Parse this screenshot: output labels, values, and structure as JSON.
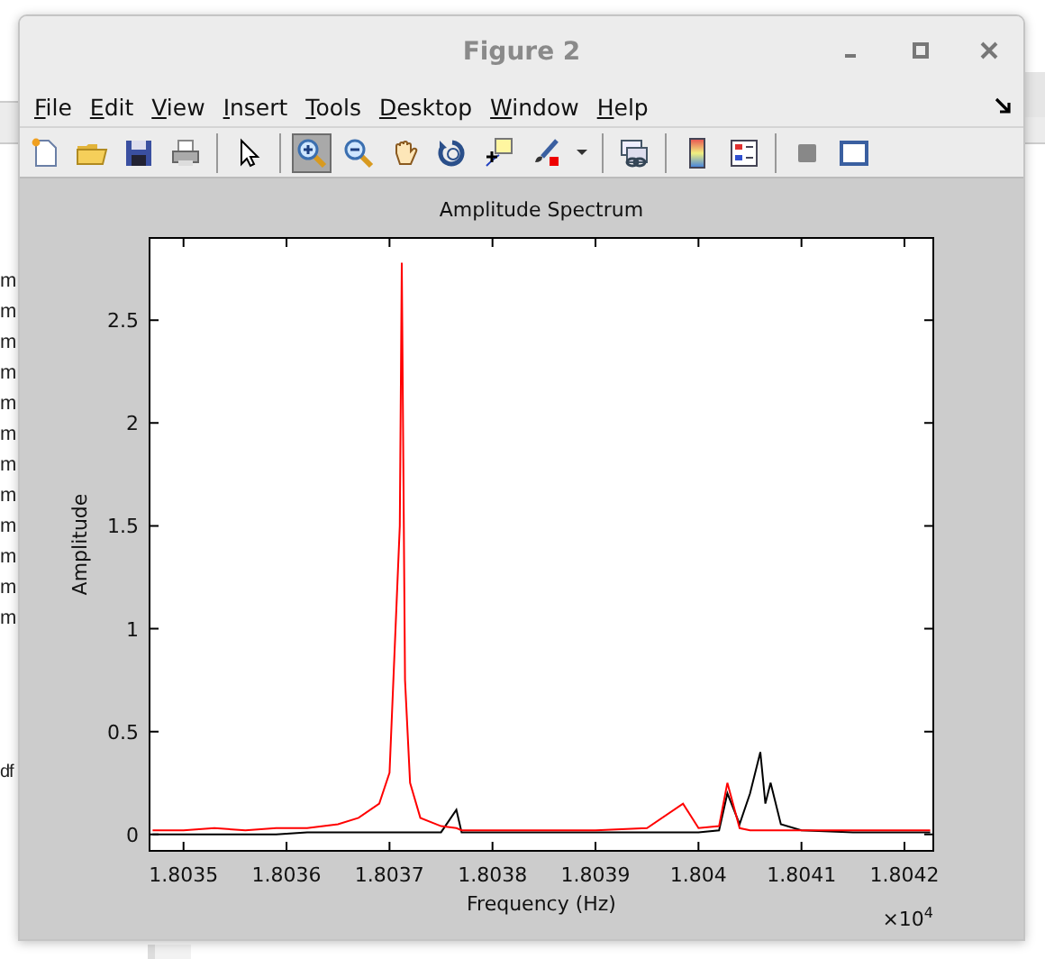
{
  "background": {
    "files_column": [
      "m",
      "m",
      "m",
      "m",
      "m",
      "m",
      "m",
      "m",
      "m",
      "m",
      "m",
      "m"
    ],
    "more_files": [
      "df"
    ]
  },
  "window": {
    "title": "Figure 2"
  },
  "menu": [
    "File",
    "Edit",
    "View",
    "Insert",
    "Tools",
    "Desktop",
    "Window",
    "Help"
  ],
  "toolbar": [
    [
      {
        "kind": "new",
        "selected": false
      },
      {
        "kind": "open",
        "selected": false
      },
      {
        "kind": "save",
        "selected": false
      },
      {
        "kind": "print",
        "selected": false
      }
    ],
    [
      {
        "kind": "pointer",
        "selected": false
      }
    ],
    [
      {
        "kind": "zoom-in",
        "selected": true
      },
      {
        "kind": "zoom-out",
        "selected": false
      },
      {
        "kind": "pan",
        "selected": false
      },
      {
        "kind": "rotate",
        "selected": false
      },
      {
        "kind": "data-cursor",
        "selected": false
      },
      {
        "kind": "brush",
        "selected": false
      },
      {
        "kind": "dropdown",
        "selected": false
      }
    ],
    [
      {
        "kind": "link",
        "selected": false
      }
    ],
    [
      {
        "kind": "colorbar",
        "selected": false
      },
      {
        "kind": "legend",
        "selected": false
      }
    ],
    [
      {
        "kind": "hide-tools",
        "selected": false
      },
      {
        "kind": "show-tools",
        "selected": false
      }
    ]
  ],
  "figure": {
    "chart_data": {
      "type": "line",
      "title": "Amplitude Spectrum",
      "xlabel": "Frequency (Hz)",
      "ylabel": "Amplitude",
      "annotations": [
        {
          "text": "×10$^{4}$"
        }
      ],
      "x": [
        1.80347,
        1.8035,
        1.80353,
        1.80356,
        1.80359,
        1.80362,
        1.80365,
        1.80367,
        1.80369,
        1.8037,
        1.80371,
        1.803712,
        1.803715,
        1.80372,
        1.80373,
        1.80375,
        1.803765,
        1.80377,
        1.8038,
        1.80385,
        1.8039,
        1.80395,
        1.803985,
        1.804,
        1.80402,
        1.804028,
        1.80404,
        1.80405,
        1.80406,
        1.804065,
        1.80407,
        1.80408,
        1.8041,
        1.80415,
        1.8042,
        1.804225
      ],
      "series": [
        {
          "color": "#000000",
          "values": [
            0,
            0,
            0,
            0,
            0,
            0.01,
            0.01,
            0.01,
            0.01,
            0.01,
            0.01,
            0.01,
            0.01,
            0.01,
            0.01,
            0.01,
            0.12,
            0.01,
            0.01,
            0.01,
            0.01,
            0.01,
            0.01,
            0.01,
            0.02,
            0.2,
            0.05,
            0.2,
            0.4,
            0.15,
            0.25,
            0.05,
            0.02,
            0.01,
            0.01,
            0.01
          ]
        },
        {
          "color": "#ff0000",
          "values": [
            0.02,
            0.02,
            0.03,
            0.02,
            0.03,
            0.03,
            0.05,
            0.08,
            0.15,
            0.3,
            1.5,
            2.78,
            0.75,
            0.25,
            0.08,
            0.04,
            0.03,
            0.02,
            0.02,
            0.02,
            0.02,
            0.03,
            0.15,
            0.03,
            0.04,
            0.25,
            0.03,
            0.02,
            0.02,
            0.02,
            0.02,
            0.02,
            0.02,
            0.02,
            0.02,
            0.02
          ]
        }
      ],
      "xlim": [
        1.803467,
        1.804228
      ],
      "ylim": [
        -0.08,
        2.9
      ],
      "xticks": [
        {
          "value": 1.8035,
          "label": "1.8035"
        },
        {
          "value": 1.8036,
          "label": "1.8036"
        },
        {
          "value": 1.8037,
          "label": "1.8037"
        },
        {
          "value": 1.8038,
          "label": "1.8038"
        },
        {
          "value": 1.8039,
          "label": "1.8039"
        },
        {
          "value": 1.804,
          "label": "1.804"
        },
        {
          "value": 1.8041,
          "label": "1.8041"
        },
        {
          "value": 1.8042,
          "label": "1.8042"
        }
      ],
      "yticks": [
        {
          "value": 0,
          "label": "0"
        },
        {
          "value": 0.5,
          "label": "0.5"
        },
        {
          "value": 1,
          "label": "1"
        },
        {
          "value": 1.5,
          "label": "1.5"
        },
        {
          "value": 2,
          "label": "2"
        },
        {
          "value": 2.5,
          "label": "2.5"
        }
      ]
    }
  }
}
